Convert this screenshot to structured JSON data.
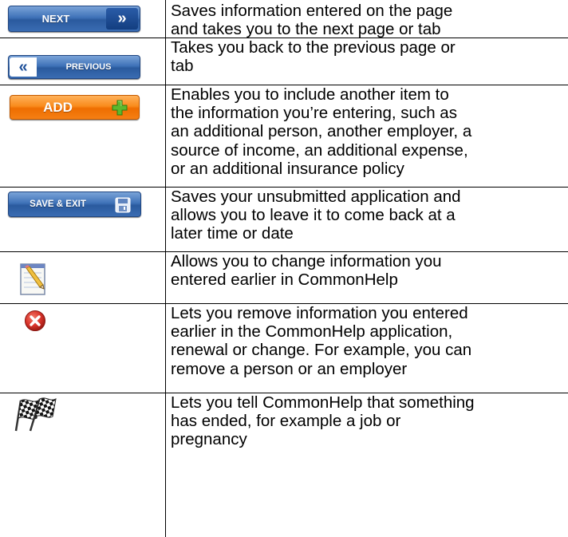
{
  "rows": [
    {
      "button_label": "NEXT",
      "icon": "double-chevron-right-icon",
      "description": "Saves information entered on the page\nand takes you to the next page or tab"
    },
    {
      "button_label": "PREVIOUS",
      "icon": "double-chevron-left-icon",
      "description": "Takes you back to the previous page or\ntab"
    },
    {
      "button_label": "ADD",
      "icon": "plus-icon",
      "description": "Enables you to include another item to\nthe information you’re entering, such as\nan additional person, another employer, a\nsource of income, an additional expense,\nor an additional insurance policy"
    },
    {
      "button_label": "SAVE & EXIT",
      "icon": "floppy-disk-icon",
      "description": "Saves your unsubmitted application and\nallows you to leave it to come back at a\nlater time or date"
    },
    {
      "icon": "edit-notepad-icon",
      "description": "Allows you to  change information you\nentered earlier in CommonHelp"
    },
    {
      "icon": "remove-x-icon",
      "description": "Lets you remove information you entered\nearlier in the  CommonHelp application,\nrenewal or change. For example, you can\nremove a person or an employer"
    },
    {
      "icon": "checkered-flag-icon",
      "description": "Lets you tell CommonHelp that something\nhas ended, for example a job or\npregnancy"
    }
  ],
  "colors": {
    "blue_button": "#3f72b8",
    "orange_button": "#f98b1c",
    "green_plus": "#5cb82e",
    "red_x": "#d9342b"
  }
}
